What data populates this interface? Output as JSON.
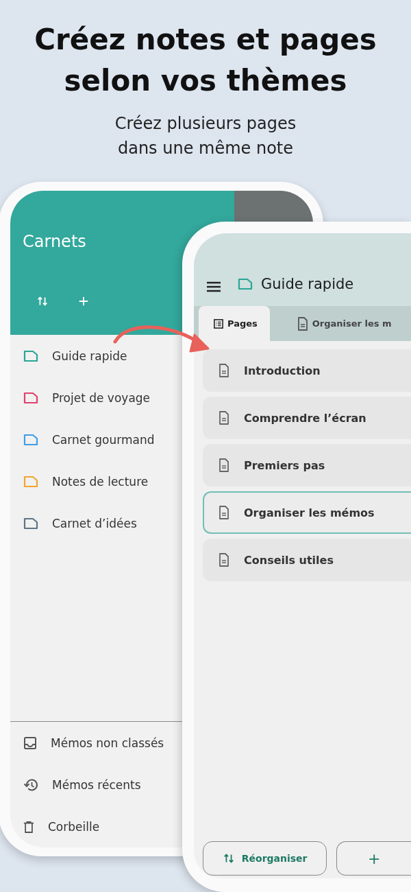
{
  "headline": {
    "lines": [
      "Créez notes et pages",
      "selon vos thèmes"
    ]
  },
  "subtitle": {
    "lines": [
      "Créez plusieurs pages",
      "dans une même note"
    ]
  },
  "drawer": {
    "title": "Carnets",
    "items": [
      {
        "label": "Guide rapide",
        "color": "#2aa597"
      },
      {
        "label": "Projet de voyage",
        "color": "#e0416e"
      },
      {
        "label": "Carnet gourmand",
        "color": "#3f9ee8"
      },
      {
        "label": "Notes de lecture",
        "color": "#f2a531"
      },
      {
        "label": "Carnet d’idées",
        "color": "#5e7584"
      }
    ],
    "footer_items": [
      {
        "label": "Mémos non classés",
        "kind": "inbox"
      },
      {
        "label": "Mémos récents",
        "kind": "history"
      },
      {
        "label": "Corbeille",
        "kind": "trash"
      }
    ]
  },
  "note": {
    "title": "Guide rapide",
    "color": "#2aa597",
    "tabs": [
      {
        "label": "Pages",
        "kind": "list",
        "selected": true
      },
      {
        "label": "Organiser les m",
        "kind": "doc",
        "selected": false
      }
    ],
    "pages": [
      {
        "label": "Introduction",
        "selected": false
      },
      {
        "label": "Comprendre l’écran",
        "selected": false
      },
      {
        "label": "Premiers pas",
        "selected": false
      },
      {
        "label": "Organiser les mémos",
        "selected": true
      },
      {
        "label": "Conseils utiles",
        "selected": false
      }
    ],
    "buttons": [
      {
        "label": "Réorganiser",
        "kind": "sort"
      },
      {
        "label": "+",
        "kind": "text"
      }
    ]
  }
}
